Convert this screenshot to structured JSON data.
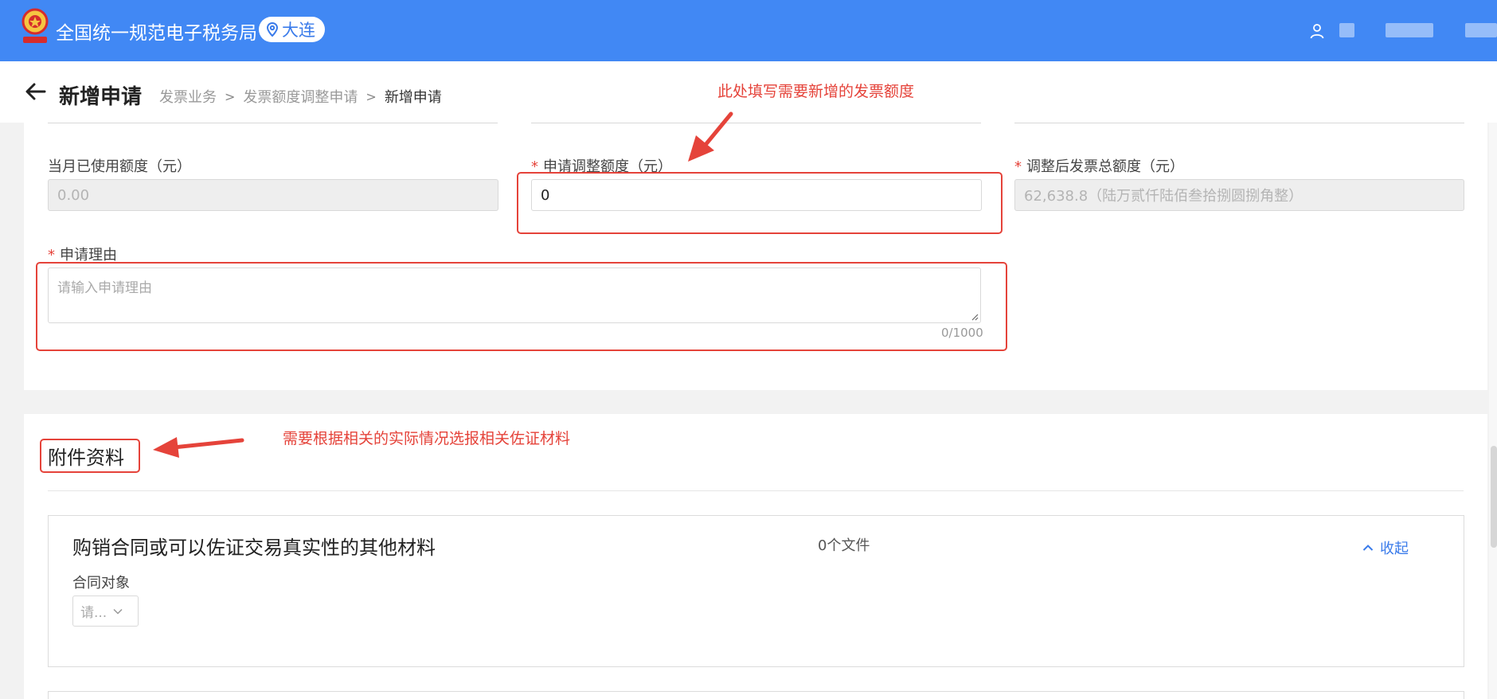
{
  "header": {
    "app_title": "全国统一规范电子税务局",
    "location": "大连",
    "colors": {
      "bar": "#4188f4",
      "accent": "#3a7bea",
      "annotation": "#e5433a"
    }
  },
  "page": {
    "title": "新增申请",
    "breadcrumb": [
      "发票业务",
      "发票额度调整申请",
      "新增申请"
    ]
  },
  "form": {
    "used_quota": {
      "label": "当月已使用额度（元）",
      "value": "0.00"
    },
    "adjust_quota": {
      "label": "申请调整额度（元）",
      "value": "0",
      "required": "*"
    },
    "total_quota": {
      "label": "调整后发票总额度（元）",
      "value": "62,638.8（陆万贰仟陆佰叁拾捌圆捌角整）",
      "required": "*"
    },
    "reason": {
      "label": "申请理由",
      "placeholder": "请输入申请理由",
      "counter": "0/1000",
      "required": "*"
    }
  },
  "annotations": {
    "quota_hint": "此处填写需要新增的发票额度",
    "attachment_hint": "需要根据相关的实际情况选报相关佐证材料"
  },
  "attachments": {
    "section_title": "附件资料",
    "panel": {
      "title": "购销合同或可以佐证交易真实性的其他材料",
      "file_count": "0个文件",
      "collapse_label": "收起",
      "contract_label": "合同对象",
      "select_placeholder": "请..."
    }
  }
}
